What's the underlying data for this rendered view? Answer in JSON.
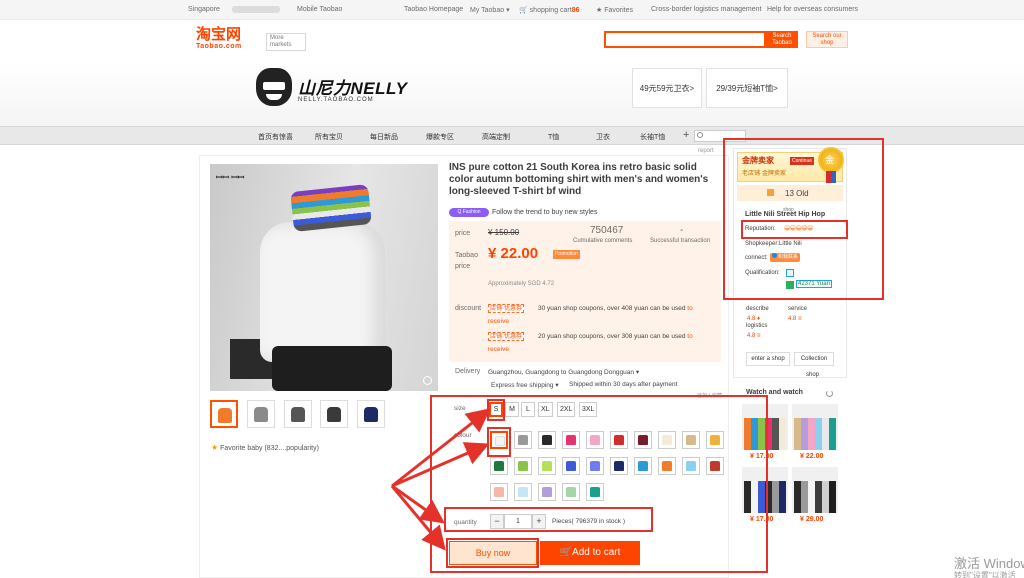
{
  "topbar": {
    "location": "Singapore",
    "mobile": "Mobile Taobao",
    "homepage": "Taobao Homepage",
    "my_taobao": "My Taobao",
    "cart_label": "shopping cart",
    "cart_count": "86",
    "favorites": "Favorites",
    "logistics": "Cross-border logistics management",
    "help": "Help for overseas consumers"
  },
  "header": {
    "logo": "淘宝网",
    "logo_sub": "Taobao.com",
    "markets": "More markets",
    "search_btn": "Search Taobao",
    "search_shop_btn": "Search our shop"
  },
  "shop": {
    "logo_text": "山尼力NELLY",
    "logo_sub": "NELLY.TAOBAO.COM",
    "promo1": "49元59元卫衣>",
    "promo2": "29/39元短袖T恤>"
  },
  "nav": {
    "items": [
      "首页有惊喜",
      "所有宝贝",
      "每日新品",
      "爆款专区",
      "高端定制",
      "T恤",
      "卫衣",
      "长袖T恤"
    ],
    "report": "report"
  },
  "product": {
    "title": "INS pure cotton 21 South Korea ins retro basic solid color autumn bottoming shirt with men's and women's long-sleeved T-shirt bf wind",
    "tag_pill": "Q Fashion",
    "tag_text": "Follow the trend to buy new styles",
    "price_label": "price",
    "old_price": "¥ 150.00",
    "cumulative_value": "750467",
    "cumulative_label": "Cumulative comments",
    "success_value": "-",
    "success_label": "Successful transaction",
    "taobao_price_label": "Taobao price",
    "new_price": "¥ 22.00",
    "promotion": "Promotion",
    "approx": "Approximately SGD 4.72",
    "discount_label": "discount",
    "coupon_tag": "店铺·优惠券",
    "coupon1_text": "30 yuan shop coupons, over 408 yuan can be used",
    "coupon2_text": "20 yuan shop coupons, over 308 yuan can be used",
    "to": "to",
    "receive": "receive",
    "delivery_label": "Delivery",
    "delivery_route": "Guangzhou, Guangdong to Guangdong Dongguan",
    "shipping": "Express free shipping",
    "shipped": "Shipped within 30 days after payment",
    "size_label": "size",
    "sizes": [
      "S",
      "M",
      "L",
      "XL",
      "2XL",
      "3XL"
    ],
    "colour_label": "colour",
    "quantity_label": "quantity",
    "quantity_value": "1",
    "stock": "Pieces( 796379 in stock )",
    "buy_now": "Buy now",
    "add_to_cart": "Add   to cart",
    "favorite": "Favorite baby (832....popularity)",
    "minus": "−",
    "plus": "+",
    "collect_small": "已加入收藏"
  },
  "sidebar": {
    "gold_title": "金牌卖家",
    "gold_chip": "Continue",
    "gold_sub": "老店铺·金牌卖家",
    "years": "13 Old",
    "shop_small": "shop",
    "shop_name": "Little Nili Street Hip Hop",
    "reputation_label": "Reputation:",
    "reputation_hearts": "😀😀😀😀😀",
    "shopkeeper": "Shopkeeper:Little Nili",
    "connect_label": "connect:",
    "wangwang": "和我联系",
    "qualification": "Qualification:",
    "deposit": "42371 Yuan",
    "describe_label": "describe",
    "describe_score": "4.8 ♦",
    "service_label": "service",
    "service_score": "4.8 ≡",
    "logistics_label": "logistics",
    "logistics_score": "4.8 ≡",
    "enter_shop": "enter a shop",
    "collection": "Collection",
    "shop_word": "shop",
    "watch_title": "Watch and watch",
    "watch_prices": [
      "¥ 17.00",
      "¥ 22.00",
      "¥ 17.00",
      "¥ 29.00"
    ]
  },
  "colors": {
    "accent": "#ff4400",
    "annotation_red": "#e4322b",
    "price_panel_bg": "#fff2e8"
  },
  "swatches": [
    "#f4f4f4",
    "#9a9a9a",
    "#2a2a2a",
    "#e8326d",
    "#f6a6c5",
    "#d42b2b",
    "#7a1d2a",
    "#f3ead8",
    "#d7b98a",
    "#f0b13a",
    "#1f7a3f",
    "#8bc34a",
    "#b6e05a",
    "#3c5bd8",
    "#6f7cf0",
    "#1e2a66",
    "#2c9ad6",
    "#f07b2a",
    "#8ad0f0",
    "#c0392b",
    "#f2b8a8",
    "#c4e6f7",
    "#b39ddb",
    "#a5d6a7",
    "#1b9e8f"
  ],
  "watermark": {
    "line1": "激活 Windows",
    "line2": "转到\"设置\"以激活"
  }
}
